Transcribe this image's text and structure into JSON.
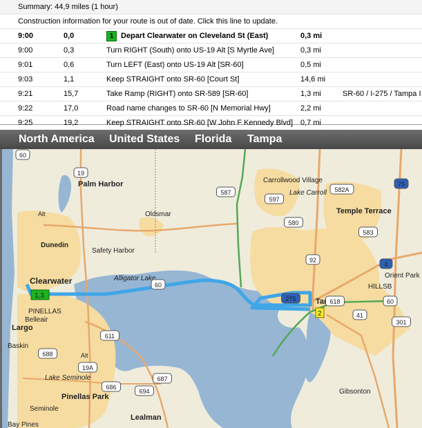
{
  "directions": {
    "summary": "Summary:  44,9 miles (1 hour)",
    "notice": "Construction information for your route is out of date.  Click this line to update.",
    "steps": [
      {
        "time": "9:00",
        "dist": "0,0",
        "badge": "1",
        "text": "Depart Clearwater on Cleveland St (East)",
        "len": "0,3 mi",
        "ref": ""
      },
      {
        "time": "9:00",
        "dist": "0,3",
        "badge": "",
        "text": "Turn RIGHT (South) onto US-19 Alt [S Myrtle Ave]",
        "len": "0,3 mi",
        "ref": ""
      },
      {
        "time": "9:01",
        "dist": "0,6",
        "badge": "",
        "text": "Turn LEFT (East) onto US-19 Alt [SR-60]",
        "len": "0,5 mi",
        "ref": ""
      },
      {
        "time": "9:03",
        "dist": "1,1",
        "badge": "",
        "text": "Keep STRAIGHT onto SR-60 [Court St]",
        "len": "14,6 mi",
        "ref": ""
      },
      {
        "time": "9:21",
        "dist": "15,7",
        "badge": "",
        "text": "Take Ramp (RIGHT) onto SR-589 [SR-60]",
        "len": "1,3 mi",
        "ref": "SR-60 / I-275 / Tampa I"
      },
      {
        "time": "9:22",
        "dist": "17,0",
        "badge": "",
        "text": "Road name changes to SR-60 [N Memorial Hwy]",
        "len": "2,2 mi",
        "ref": ""
      },
      {
        "time": "9:25",
        "dist": "19,2",
        "badge": "",
        "text": "Keep STRAIGHT onto SR-60 [W John F Kennedy Blvd]",
        "len": "0,7 mi",
        "ref": ""
      }
    ]
  },
  "breadcrumb": [
    "North America",
    "United States",
    "Florida",
    "Tampa"
  ],
  "map": {
    "places": [
      "Palm Harbor",
      "Oldsmar",
      "Carrollwood Village",
      "Lake Carroll",
      "Temple Terrace",
      "Dunedin",
      "Safety Harbor",
      "Alligator Lake",
      "Clearwater",
      "PINELLAS",
      "Belleair",
      "Largo",
      "Baskin",
      "Lake Seminole",
      "Pinellas Park",
      "Seminole",
      "Bay Pines",
      "Lealman",
      "Tampa",
      "Orient Park",
      "HILLSB",
      "Gibsonton"
    ],
    "shields": [
      "19",
      "587",
      "597",
      "582A",
      "75",
      "580",
      "583",
      "92",
      "4",
      "618",
      "60",
      "41",
      "301",
      "611",
      "688",
      "19A",
      "686",
      "687",
      "694",
      "60",
      "275",
      "60"
    ],
    "at_labels": [
      "Alt",
      "Alt"
    ],
    "markers": {
      "start": "1,3",
      "end": "2"
    },
    "colors": {
      "water": "#97b6d4",
      "land": "#efecdc",
      "urban": "#f6dca1",
      "route": "#3fa6e8",
      "highway": "#e8a86b",
      "green_road": "#55a855"
    }
  }
}
